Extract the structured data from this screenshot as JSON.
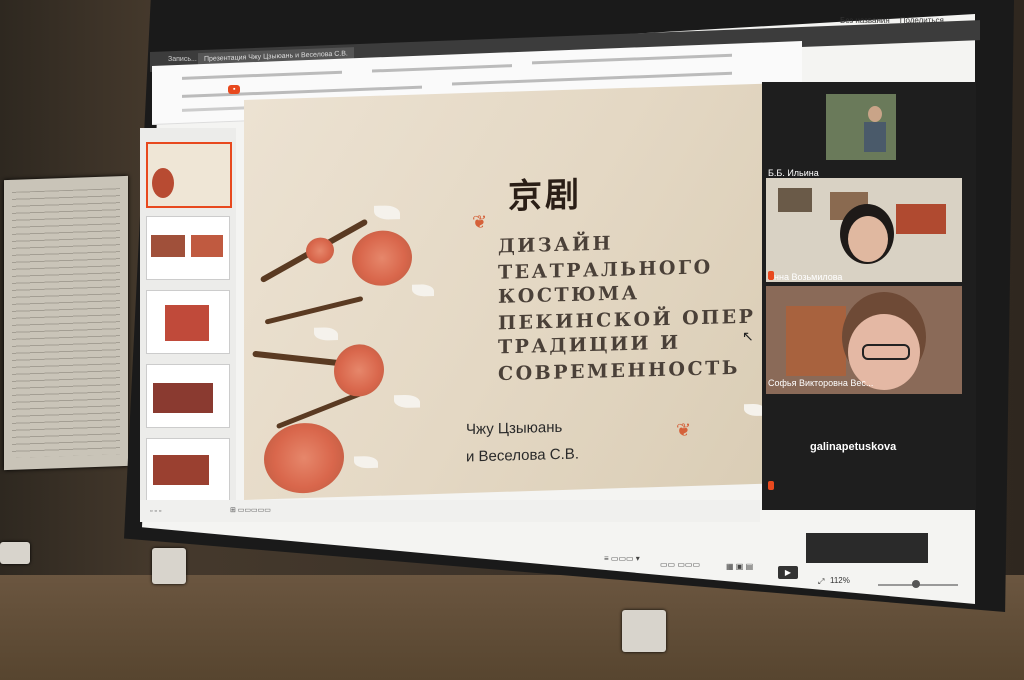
{
  "browser": {
    "url_text": "Запись...",
    "tabs": [
      "Презентация Чжу Цзыюань и Веселова С.В."
    ],
    "top_right_labels": [
      "Без названия",
      "Поделиться"
    ]
  },
  "slide": {
    "title_cn": "京剧",
    "title_lines": [
      "ДИЗАЙН",
      "ТЕАТРАЛЬНОГО",
      "КОСТЮМА",
      "ПЕКИНСКОЙ ОПЕР",
      "ТРАДИЦИИ И",
      "СОВРЕМЕННОСТЬ"
    ],
    "authors": [
      "Чжу Цзыюань",
      "и Веселова С.В."
    ]
  },
  "participants": [
    {
      "name": "Б.Б. Ильина"
    },
    {
      "name": "Анна Возьмилова"
    },
    {
      "name": "Софья Викторовна Вес..."
    },
    {
      "name": "galinapetuskova"
    }
  ],
  "zoom": {
    "level": "112%"
  },
  "colors": {
    "accent": "#e8491e",
    "slide_bg": "#e4d8c4",
    "flower": "#d9674c"
  }
}
